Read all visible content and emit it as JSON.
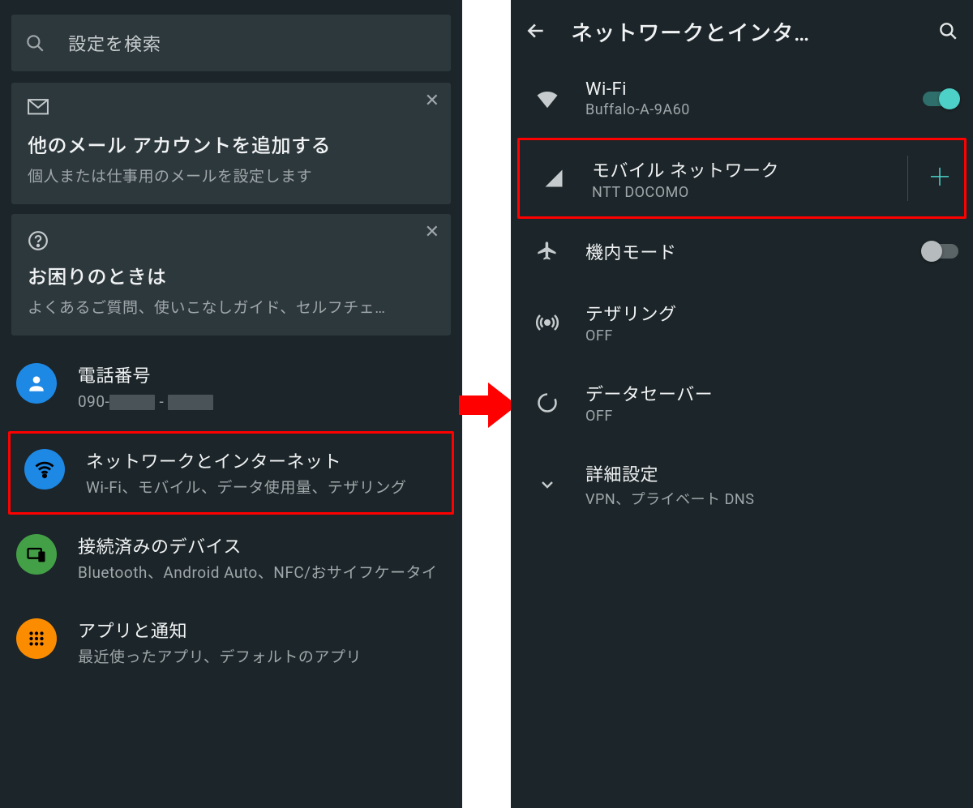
{
  "left": {
    "search_placeholder": "設定を検索",
    "card_mail": {
      "title": "他のメール アカウントを追加する",
      "subtitle": "個人または仕事用のメールを設定します"
    },
    "card_help": {
      "title": "お困りのときは",
      "subtitle": "よくあるご質問、使いこなしガイド、セルフチェ…"
    },
    "rows": {
      "phone": {
        "title": "電話番号",
        "prefix": "090-"
      },
      "network": {
        "title": "ネットワークとインターネット",
        "subtitle": "Wi-Fi、モバイル、データ使用量、テザリング"
      },
      "devices": {
        "title": "接続済みのデバイス",
        "subtitle": "Bluetooth、Android Auto、NFC/おサイフケータイ"
      },
      "apps": {
        "title": "アプリと通知",
        "subtitle": "最近使ったアプリ、デフォルトのアプリ"
      }
    }
  },
  "right": {
    "header_title": "ネットワークとインタ…",
    "wifi": {
      "title": "Wi-Fi",
      "subtitle": "Buffalo-A-9A60",
      "on": true
    },
    "mobile": {
      "title": "モバイル ネットワーク",
      "subtitle": "NTT DOCOMO"
    },
    "airplane": {
      "title": "機内モード",
      "on": false
    },
    "tether": {
      "title": "テザリング",
      "subtitle": "OFF"
    },
    "saver": {
      "title": "データセーバー",
      "subtitle": "OFF"
    },
    "advanced": {
      "title": "詳細設定",
      "subtitle": "VPN、プライベート DNS"
    }
  }
}
